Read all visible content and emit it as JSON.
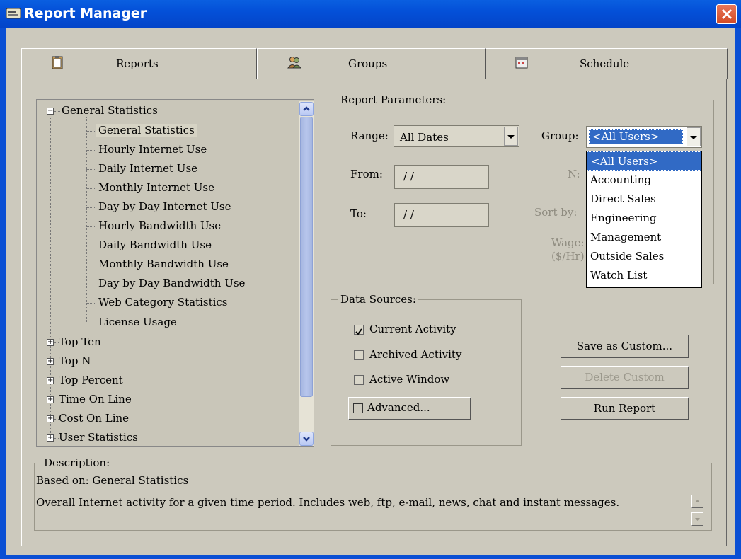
{
  "window": {
    "title": "Report Manager"
  },
  "tabs": [
    {
      "label": "Reports",
      "icon": "clipboard-icon"
    },
    {
      "label": "Groups",
      "icon": "users-icon"
    },
    {
      "label": "Schedule",
      "icon": "calendar-icon"
    }
  ],
  "tree": {
    "root": "General Statistics",
    "children": [
      "General Statistics",
      "Hourly Internet Use",
      "Daily Internet Use",
      "Monthly Internet Use",
      "Day by Day Internet Use",
      "Hourly Bandwidth Use",
      "Daily Bandwidth Use",
      "Monthly Bandwidth Use",
      "Day by Day Bandwidth Use",
      "Web Category Statistics",
      "License Usage"
    ],
    "collapsed": [
      "Top Ten",
      "Top N",
      "Top Percent",
      "Time On Line",
      "Cost On Line",
      "User Statistics"
    ]
  },
  "params": {
    "legend": "Report Parameters:",
    "range_label": "Range:",
    "range_value": "All Dates",
    "from_label": "From:",
    "from_value": "/ /",
    "to_label": "To:",
    "to_value": "/ /",
    "group_label": "Group:",
    "group_value": "<All Users>",
    "n_label": "N:",
    "sortby_label": "Sort by:",
    "wage_label": "Wage:",
    "wage_unit": "($/Hr)",
    "group_options": [
      "<All Users>",
      "Accounting",
      "Direct Sales",
      "Engineering",
      "Management",
      "Outside Sales",
      "Watch List"
    ]
  },
  "sources": {
    "legend": "Data Sources:",
    "current": "Current Activity",
    "archived": "Archived Activity",
    "window": "Active Window",
    "advanced": "Advanced..."
  },
  "buttons": {
    "save": "Save as Custom...",
    "delete": "Delete Custom",
    "run": "Run Report"
  },
  "description": {
    "legend": "Description:",
    "based_on": "Based on: General Statistics",
    "text": "Overall Internet activity for a given time period.  Includes web, ftp, e-mail, news, chat and instant messages."
  }
}
